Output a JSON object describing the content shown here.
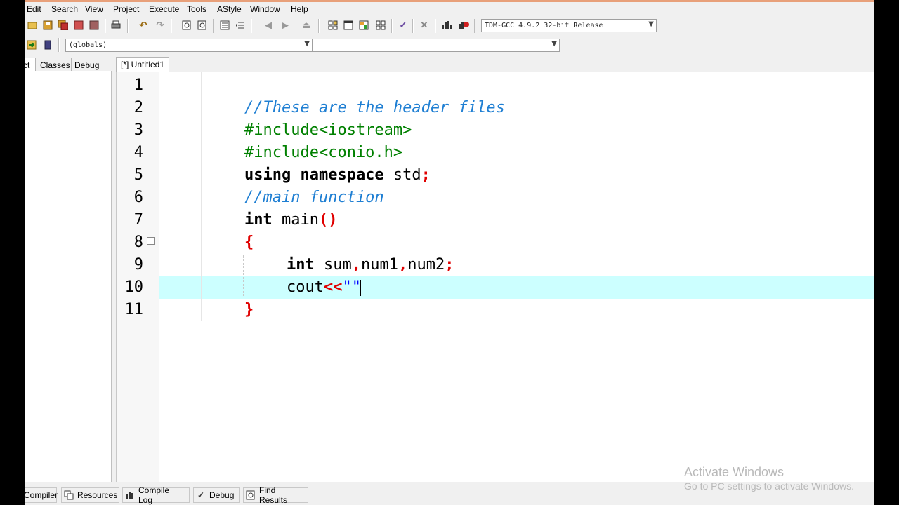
{
  "menu": {
    "items": [
      "Edit",
      "Search",
      "View",
      "Project",
      "Execute",
      "Tools",
      "AStyle",
      "Window",
      "Help"
    ]
  },
  "toolbar": {
    "compiler_select": "TDM-GCC 4.9.2 32-bit Release",
    "scope_select": "(globals)",
    "function_select": ""
  },
  "left_tabs": [
    "ct",
    "Classes",
    "Debug"
  ],
  "editor": {
    "tab_label": "[*] Untitled1",
    "line_numbers": [
      "1",
      "2",
      "3",
      "4",
      "5",
      "6",
      "7",
      "8",
      "9",
      "10",
      "11"
    ],
    "lines": {
      "l2_comment": "//These are the header files",
      "l3": "#include<iostream>",
      "l4": "#include<conio.h>",
      "l5_kw": "using namespace",
      "l5_id": " std",
      "l5_semi": ";",
      "l6_comment": "//main function",
      "l7_kw": "int",
      "l7_id": " main",
      "l7_parens": "()",
      "l8_brace": "{",
      "l9_kw": "int",
      "l9_a": " sum",
      "l9_c1": ",",
      "l9_b": "num1",
      "l9_c2": ",",
      "l9_c": "num2",
      "l9_semi": ";",
      "l10_id": "cout",
      "l10_op": "<<",
      "l10_str": "\"\"",
      "l11_brace": "}"
    }
  },
  "bottom_tabs": [
    "Compiler",
    "Resources",
    "Compile Log",
    "Debug",
    "Find Results"
  ],
  "watermark": {
    "line1": "Activate Windows",
    "line2": "Go to PC settings to activate Windows."
  }
}
